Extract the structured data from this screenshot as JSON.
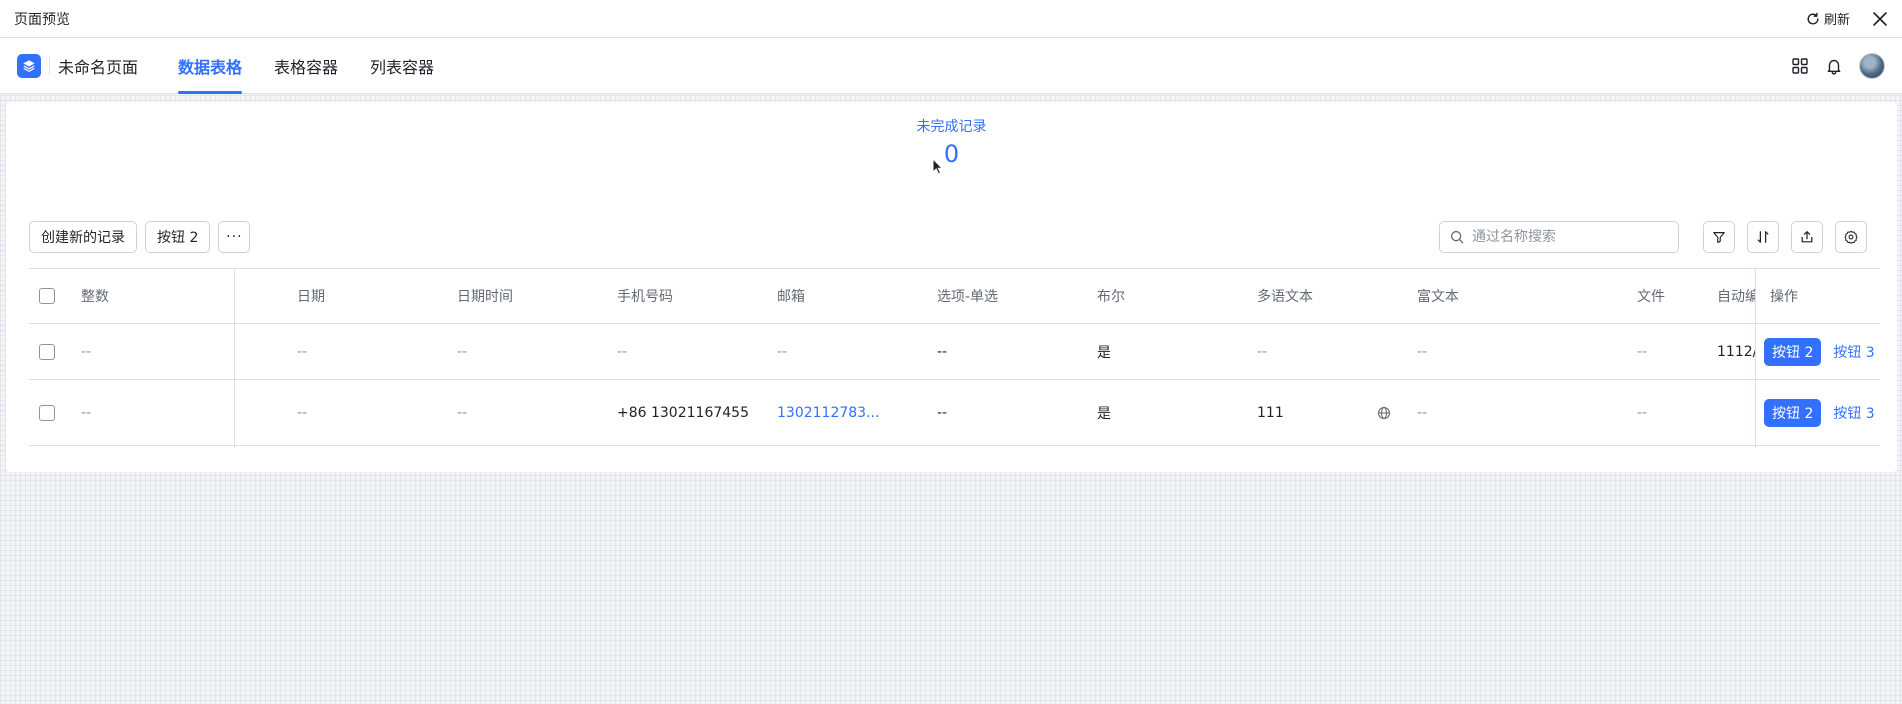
{
  "preview": {
    "title": "页面预览",
    "refresh_label": "刷新"
  },
  "header": {
    "app_name": "未命名页面",
    "tabs": [
      {
        "label": "数据表格",
        "active": true
      },
      {
        "label": "表格容器",
        "active": false
      },
      {
        "label": "列表容器",
        "active": false
      }
    ]
  },
  "stat": {
    "label": "未完成记录",
    "value": "0"
  },
  "toolbar": {
    "create_label": "创建新的记录",
    "button2_label": "按钮 2",
    "more_label": "···",
    "search_placeholder": "通过名称搜索"
  },
  "table": {
    "columns": [
      "整数",
      "日期",
      "日期时间",
      "手机号码",
      "邮箱",
      "选项-单选",
      "布尔",
      "多语文本",
      "富文本",
      "文件",
      "自动编",
      "操作"
    ],
    "rows": [
      {
        "integer": "--",
        "date": "--",
        "datetime": "--",
        "phone": "--",
        "email": "--",
        "single_select": "--",
        "boolean": "是",
        "multilang": "--",
        "richtext": "--",
        "file": "--",
        "auto": "1112/",
        "op_primary": "按钮 2",
        "op_secondary": "按钮 3"
      },
      {
        "integer": "--",
        "date": "--",
        "datetime": "--",
        "phone": "+86 13021167455",
        "email": "1302112783...",
        "single_select": "--",
        "boolean": "是",
        "multilang": "111",
        "richtext": "--",
        "file": "--",
        "auto": "",
        "op_primary": "按钮 2",
        "op_secondary": "按钮 3"
      }
    ]
  },
  "colors": {
    "accent": "#3370ff",
    "border": "#dee0e3",
    "muted_text": "#8f959e"
  },
  "icons": {
    "refresh": "refresh-icon",
    "close": "close-icon",
    "logo": "layers-icon",
    "apps": "grid-icon",
    "bell": "bell-icon",
    "search": "search-icon",
    "filter": "filter-icon",
    "sort": "sort-icon",
    "export": "export-icon",
    "settings": "gear-icon",
    "globe": "globe-icon"
  }
}
